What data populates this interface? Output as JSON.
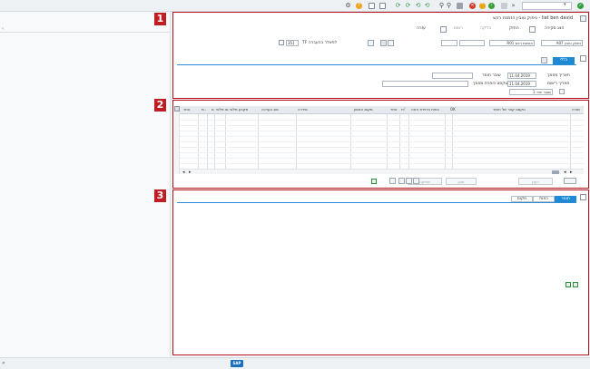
{
  "toolbar": {
    "command_field_value": "",
    "icons": [
      "checkmark-icon",
      "save-icon",
      "back-icon",
      "exit-icon",
      "cancel-icon",
      "print-icon",
      "find-icon",
      "find-next-icon",
      "first-page-icon",
      "prev-page-icon",
      "next-page-icon",
      "last-page-icon",
      "new-session-icon",
      "shortcut-icon",
      "help-icon",
      "customize-icon"
    ],
    "colors": {
      "ok": "#2e9e3e",
      "back": "#3a9e3a",
      "exit": "#e8a317",
      "cancel": "#d53a2c",
      "help": "#f0a21a"
    }
  },
  "status": {
    "logo": "SAP",
    "collapse": "«"
  },
  "left_pane": {
    "text": "‹"
  },
  "sections": {
    "badge1": "1",
    "badge2": "2",
    "badge3": "3"
  },
  "header": {
    "title": "ניפוק טובין הזמנת רכש - liat ben david",
    "toolbar": {
      "hide_overview": "הצג סקירה",
      "hold": "החזק",
      "check": "בדיקה",
      "post": "רשום",
      "help": "עזרה"
    },
    "action": "A07 ניפוק טובין",
    "reference": "R01 הזמנת רכש",
    "mvt_type": "351",
    "gr_label": "לפאלר בהעברה",
    "gr_code": "TF"
  },
  "general_tab": "כללי",
  "doc": {
    "date_doc_label": "תאריך מסמך",
    "date_doc_value": "11.04.2019",
    "date_post_label": "תאריך רישום",
    "date_post_value": "11.04.2019",
    "material_slip_label": "שובר חומר",
    "header_text_label": "טקסט כותרת מסמך",
    "slip_option": "1 שובר יחיד"
  },
  "grid": {
    "headers": [
      "שורה",
      "טקסט קצר של חומר",
      "OK",
      "כמות ביחידת הזנה",
      "יח'",
      "אתר",
      "מקום אחסון",
      "סידרה",
      "סוג הערכה",
      "מקבע מלאי",
      "סו מלאי",
      "ס",
      "מ..",
      "אתר"
    ],
    "rows": 10
  },
  "grid_buttons": {
    "del": "מחיקה",
    "contents": "תוכן",
    "refresh": "רענן"
  },
  "detail_tabs": {
    "material": "חומר",
    "quantity": "כמות",
    "where": "מקום"
  }
}
